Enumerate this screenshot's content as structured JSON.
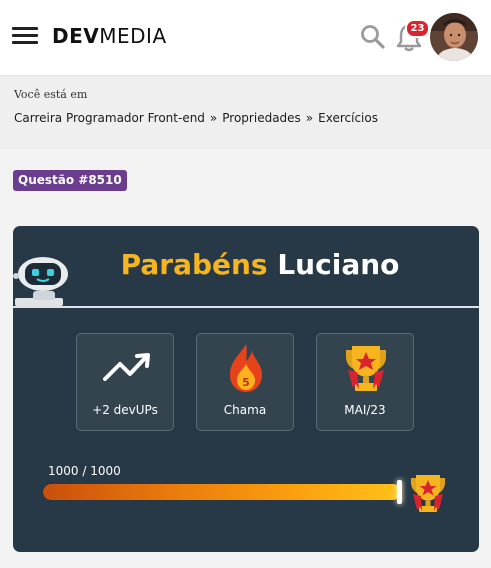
{
  "header": {
    "logo_bold": "DEV",
    "logo_light": "MEDIA",
    "notifications_count": "23",
    "icons": [
      "menu-icon",
      "search-icon",
      "bell-icon",
      "avatar"
    ]
  },
  "breadcrumb": {
    "hint": "Você está em",
    "items": [
      "Carreira Programador Front-end",
      "Propriedades",
      "Exercícios"
    ],
    "separator": "»"
  },
  "question_tag": "Questão #8510",
  "card": {
    "title_part1": "Parabéns",
    "title_part2": "Luciano",
    "stats": [
      {
        "label": "+2 devUPs",
        "icon": "trending-up-icon"
      },
      {
        "label": "Chama",
        "icon": "flame-icon",
        "value": "5"
      },
      {
        "label": "MAI/23",
        "icon": "trophy-icon"
      }
    ],
    "progress_label": "1000 / 1000",
    "progress_fraction": 1.0
  },
  "colors": {
    "card_bg": "#273846",
    "accent_yellow": "#f6b51e",
    "tag_purple": "#6a3d8f",
    "badge_red": "#d9232e"
  }
}
